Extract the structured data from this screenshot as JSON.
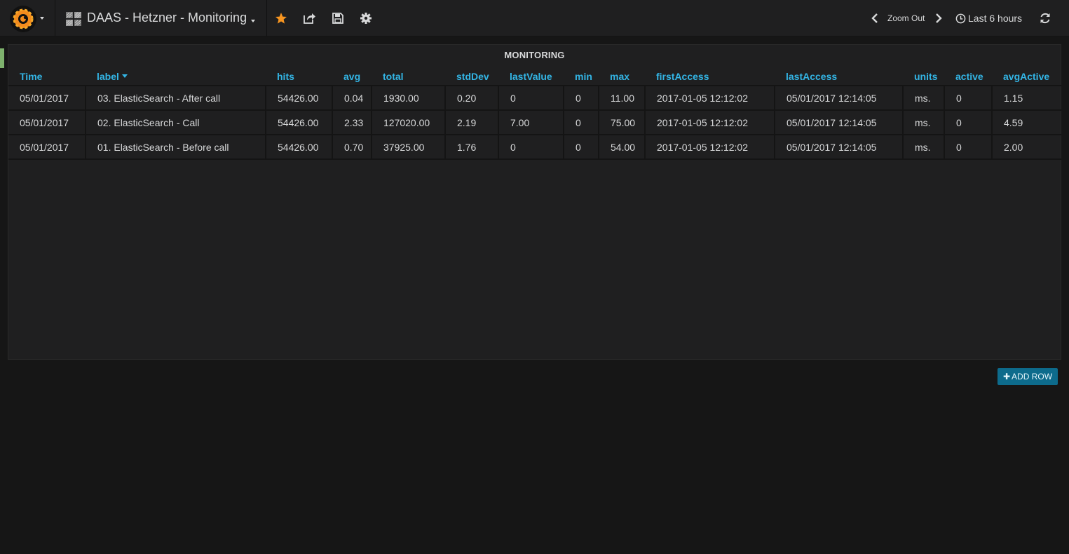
{
  "navbar": {
    "dashboard_title": "DAAS - Hetzner - Monitoring",
    "zoom_out_label": "Zoom Out",
    "time_range_label": "Last 6 hours",
    "icons": [
      "grafana-logo",
      "dashboard-grid-icon",
      "star-icon",
      "share-icon",
      "save-icon",
      "settings-gear-icon",
      "chevron-left-icon",
      "chevron-right-icon",
      "clock-icon",
      "refresh-icon"
    ],
    "star_color": "#f79520"
  },
  "panel": {
    "title": "MONITORING",
    "sort_column": "label",
    "columns": [
      "Time",
      "label",
      "hits",
      "avg",
      "total",
      "stdDev",
      "lastValue",
      "min",
      "max",
      "firstAccess",
      "lastAccess",
      "units",
      "active",
      "avgActive"
    ],
    "rows": [
      [
        "05/01/2017",
        "03. ElasticSearch - After call",
        "54426.00",
        "0.04",
        "1930.00",
        "0.20",
        "0",
        "0",
        "11.00",
        "2017-01-05 12:12:02",
        "05/01/2017 12:14:05",
        "ms.",
        "0",
        "1.15"
      ],
      [
        "05/01/2017",
        "02. ElasticSearch - Call",
        "54426.00",
        "2.33",
        "127020.00",
        "2.19",
        "7.00",
        "0",
        "75.00",
        "2017-01-05 12:12:02",
        "05/01/2017 12:14:05",
        "ms.",
        "0",
        "4.59"
      ],
      [
        "05/01/2017",
        "01. ElasticSearch - Before call",
        "54426.00",
        "0.70",
        "37925.00",
        "1.76",
        "0",
        "0",
        "54.00",
        "2017-01-05 12:12:02",
        "05/01/2017 12:14:05",
        "ms.",
        "0",
        "2.00"
      ]
    ]
  },
  "add_row_label": "ADD ROW",
  "colors": {
    "header_link": "#33b5e5",
    "row_indicator": "#7eb26d",
    "add_row_button": "#0d6b8c"
  }
}
